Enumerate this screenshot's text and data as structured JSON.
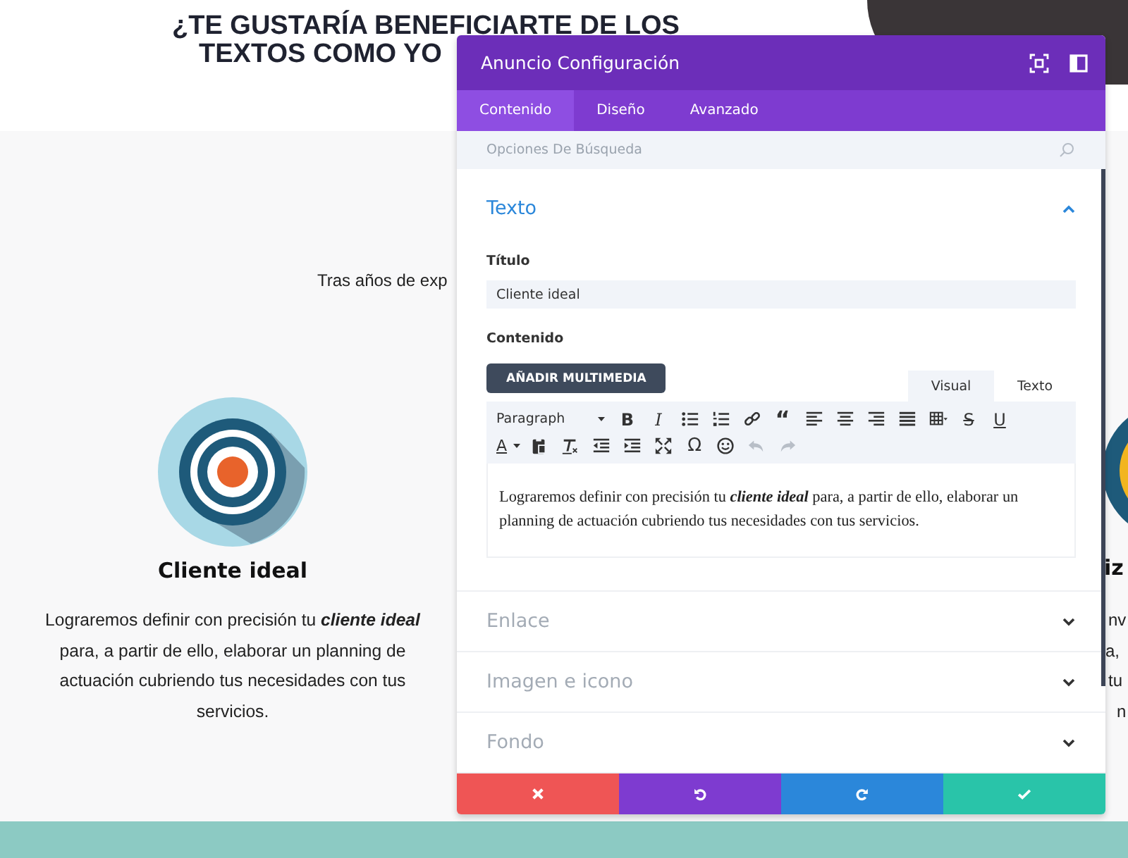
{
  "page": {
    "heading_lines": [
      "¿TE GUSTARÍA BENEFICIARTE DE LOS",
      "TEXTOS COMO YO"
    ],
    "intro": "Tras años de exp",
    "feature": {
      "title": "Cliente ideal",
      "text": "Lograremos definir con precisión tu **cliente ideal** para, a partir de ello, elaborar un planning de actuación cubriendo tus necesidades con tus servicios."
    },
    "side_feature": {
      "title": "iz",
      "lines": [
        "nv",
        "a,",
        "tu",
        "n"
      ]
    }
  },
  "modal": {
    "title": "Anuncio Configuración",
    "tabs": [
      {
        "label": "Contenido",
        "selected": true
      },
      {
        "label": "Diseño",
        "selected": false
      },
      {
        "label": "Avanzado",
        "selected": false
      }
    ],
    "search": {
      "placeholder": "Opciones De Búsqueda"
    },
    "sections": [
      {
        "title": "Texto",
        "expanded": true
      },
      {
        "title": "Enlace",
        "expanded": false
      },
      {
        "title": "Imagen e icono",
        "expanded": false
      },
      {
        "title": "Fondo",
        "expanded": false
      }
    ],
    "text_section": {
      "title_label": "Título",
      "title_value": "Cliente ideal",
      "content_label": "Contenido",
      "media_button": "AÑADIR MULTIMEDIA",
      "editor_tabs": [
        {
          "label": "Visual",
          "selected": true
        },
        {
          "label": "Texto",
          "selected": false
        }
      ],
      "toolbar": [
        [
          {
            "kind": "dropdown",
            "label": "Paragraph",
            "disabled": false
          },
          {
            "kind": "bold",
            "label": "B",
            "disabled": false
          },
          {
            "kind": "italic",
            "label": "I",
            "disabled": false
          },
          {
            "kind": "bullets",
            "disabled": false
          },
          {
            "kind": "numbering",
            "disabled": false
          },
          {
            "kind": "link",
            "disabled": false
          },
          {
            "kind": "quote",
            "label": "“",
            "disabled": false
          },
          {
            "kind": "alignleft",
            "disabled": false
          },
          {
            "kind": "aligncenter",
            "disabled": false
          },
          {
            "kind": "alignright",
            "disabled": false
          },
          {
            "kind": "justify",
            "disabled": false
          },
          {
            "kind": "table",
            "disabled": false
          },
          {
            "kind": "strike",
            "label": "S",
            "disabled": false
          },
          {
            "kind": "underline",
            "label": "U",
            "disabled": false
          }
        ],
        [
          {
            "kind": "color",
            "label": "A",
            "disabled": false
          },
          {
            "kind": "paste",
            "disabled": false
          },
          {
            "kind": "clearformat",
            "disabled": false
          },
          {
            "kind": "outdent",
            "disabled": false
          },
          {
            "kind": "indent",
            "disabled": false
          },
          {
            "kind": "fullscreen",
            "disabled": false
          },
          {
            "kind": "symbol",
            "label": "Ω",
            "disabled": false
          },
          {
            "kind": "emoji",
            "disabled": false
          },
          {
            "kind": "undo",
            "disabled": true
          },
          {
            "kind": "redo",
            "disabled": true
          }
        ]
      ],
      "content": "Lograremos definir con precisión tu **cliente ideal** para, a partir de ello, elaborar un planning de actuación cubriendo tus necesidades con tus servicios."
    },
    "footer_buttons": [
      {
        "kind": "cancel"
      },
      {
        "kind": "undo"
      },
      {
        "kind": "redo"
      },
      {
        "kind": "save"
      }
    ]
  }
}
